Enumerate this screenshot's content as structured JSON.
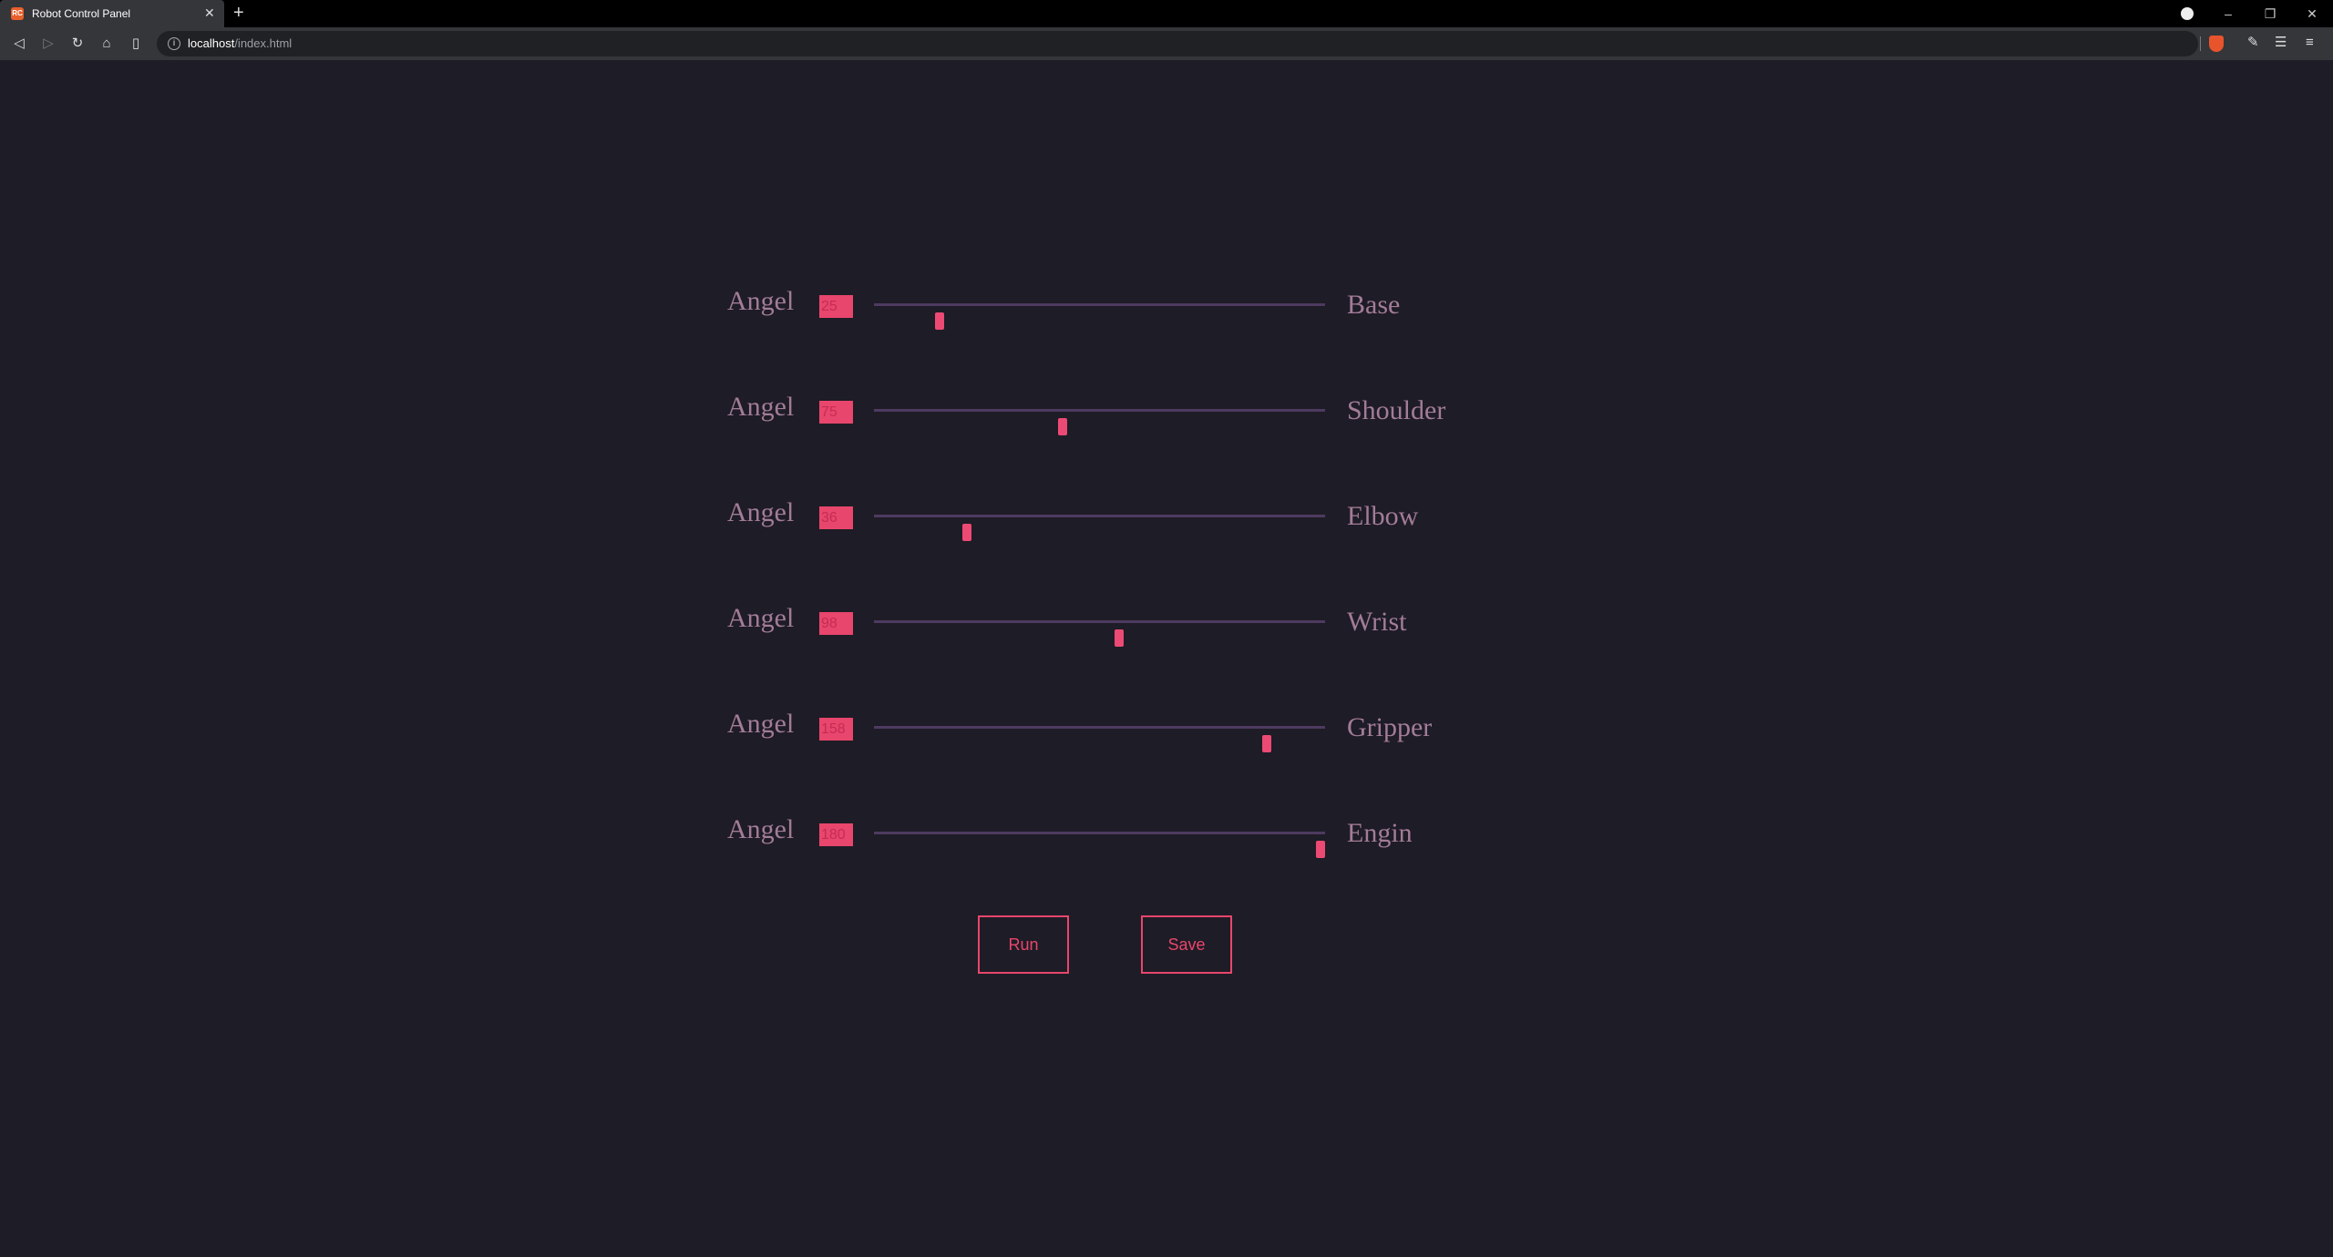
{
  "browser": {
    "tab_title": "Robot Control Panel",
    "favicon_text": "RC",
    "new_tab_symbol": "+",
    "close_symbol": "✕",
    "url_host": "localhost",
    "url_path": "/index.html"
  },
  "controls": {
    "angle_label": "Angel",
    "min": 0,
    "max": 180,
    "joints": [
      {
        "name": "Base",
        "value": "25"
      },
      {
        "name": "Shoulder",
        "value": "75"
      },
      {
        "name": "Elbow",
        "value": "36"
      },
      {
        "name": "Wrist",
        "value": "98"
      },
      {
        "name": "Gripper",
        "value": "158"
      },
      {
        "name": "Engin",
        "value": "180"
      }
    ]
  },
  "buttons": {
    "run_label": "Run",
    "save_label": "Save"
  },
  "colors": {
    "background": "#1e1c26",
    "accent": "#e8466c",
    "label": "#a27c98",
    "track": "#4e3a60"
  }
}
